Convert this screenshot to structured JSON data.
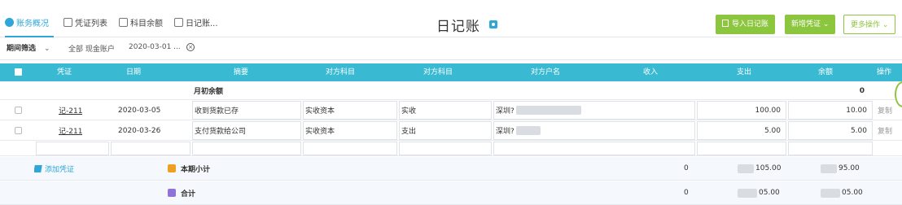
{
  "tabs": [
    {
      "label": "账务概况",
      "active": true
    },
    {
      "label": "凭证列表",
      "active": false
    },
    {
      "label": "科目余额",
      "active": false
    },
    {
      "label": "日记账...",
      "active": false
    }
  ],
  "title": "日记账",
  "toolbar": {
    "import_label": "导入日记账",
    "new_label": "新增凭证",
    "more_label": "更多操作"
  },
  "filter": {
    "dropdown_label": "期间筛选",
    "account_text": "全部 现金账户",
    "date_text": "2020-03-01 ..."
  },
  "table": {
    "headers": [
      "凭证",
      "日期",
      "摘要",
      "对方科目",
      "对方科目",
      "对方户名",
      "收入",
      "支出",
      "余额",
      "操作"
    ],
    "opening_row": {
      "label": "月初余额",
      "balance": "0"
    },
    "rows": [
      {
        "voucher": "记-211",
        "date": "2020-03-05",
        "summary": "收到货款已存",
        "account1": "实收资本",
        "account2": "实收",
        "counterparty": "深圳?",
        "income": "",
        "expense": "100.00",
        "balance": "10.00",
        "action": "复制"
      },
      {
        "voucher": "记-211",
        "date": "2020-03-26",
        "summary": "支付货款给公司",
        "account1": "实收资本",
        "account2": "支出",
        "counterparty": "深圳?",
        "income": "",
        "expense": "5.00",
        "balance": "5.00",
        "action": "复制"
      }
    ],
    "summary": {
      "add_label": "添加凭证",
      "month_label": "本期小计",
      "total_label": "合计",
      "month_income": "0",
      "month_expense": "105.00",
      "month_balance": "95.00",
      "total_income": "0",
      "total_expense": "05.00",
      "total_balance": "05.00"
    }
  },
  "colors": {
    "header_bg": "#3ab9d3",
    "accent": "#2ea7d8",
    "green": "#8cc63f"
  }
}
